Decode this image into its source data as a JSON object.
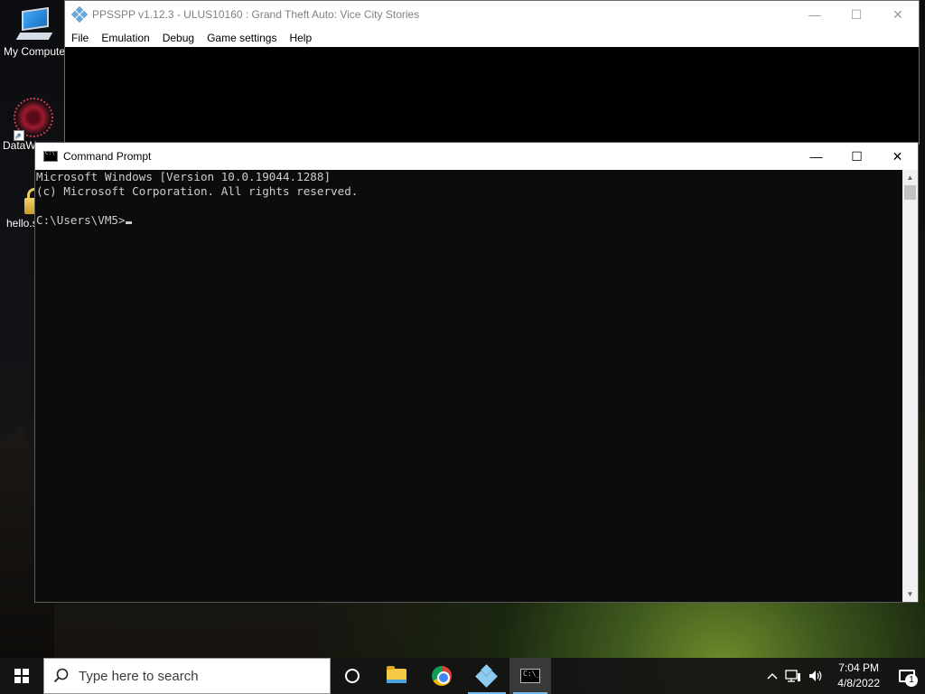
{
  "desktop": {
    "icons": [
      {
        "label": "My Compute"
      },
      {
        "label": "DataW"
      },
      {
        "label": "hello.s"
      }
    ]
  },
  "ppsspp": {
    "title": "PPSSPP v1.12.3 - ULUS10160 : Grand Theft Auto: Vice City Stories",
    "menu": [
      "File",
      "Emulation",
      "Debug",
      "Game settings",
      "Help"
    ],
    "controls": {
      "minimize": "—",
      "maximize": "☐",
      "close": "✕"
    }
  },
  "cmd": {
    "title": "Command Prompt",
    "lines": [
      "Microsoft Windows [Version 10.0.19044.1288]",
      "(c) Microsoft Corporation. All rights reserved.",
      "",
      "C:\\Users\\VM5>"
    ],
    "controls": {
      "minimize": "—",
      "maximize": "☐",
      "close": "✕"
    }
  },
  "taskbar": {
    "search_placeholder": "Type here to search",
    "pinned": [
      "cortana-icon",
      "file-explorer-icon",
      "chrome-icon",
      "ppsspp-icon",
      "command-prompt-icon"
    ],
    "time": "7:04 PM",
    "date": "4/8/2022",
    "notification_count": "1"
  },
  "colors": {
    "accent": "#76b9ed",
    "console_bg": "#0c0c0c",
    "console_text": "#cccccc"
  }
}
